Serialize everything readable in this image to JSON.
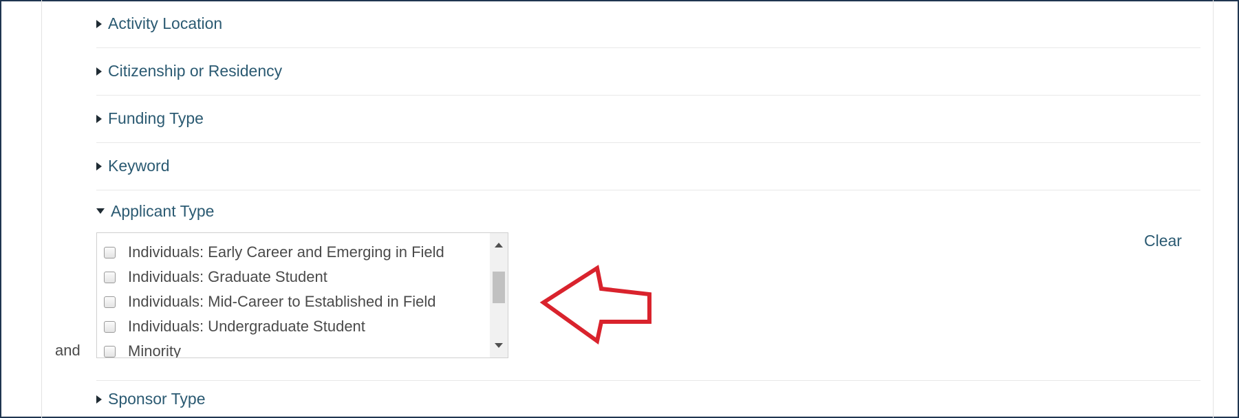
{
  "filters": {
    "activity_location": "Activity Location",
    "citizenship": "Citizenship or Residency",
    "funding_type": "Funding Type",
    "keyword": "Keyword",
    "applicant_type": "Applicant Type",
    "sponsor_type": "Sponsor Type"
  },
  "applicant_type_options": [
    "Individuals: Early Career and Emerging in Field",
    "Individuals: Graduate Student",
    "Individuals: Mid-Career to Established in Field",
    "Individuals: Undergraduate Student",
    "Minority"
  ],
  "clear_label": "Clear",
  "conjunction_label": "and",
  "annotation": {
    "arrow_color": "#d9232d"
  },
  "colors": {
    "link": "#2b5a72",
    "border": "#1f3550"
  }
}
